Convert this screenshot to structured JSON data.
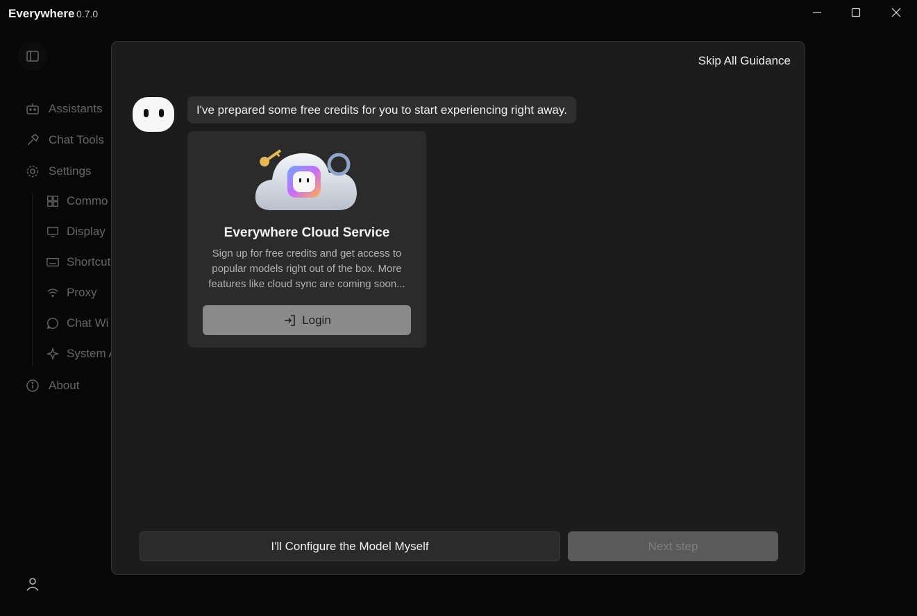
{
  "app": {
    "title": "Everywhere",
    "version": "0.7.0"
  },
  "window_controls": {
    "minimize": "minimize-icon",
    "maximize": "maximize-icon",
    "close": "close-icon"
  },
  "sidebar": {
    "items": [
      {
        "label": "Assistants",
        "icon": "robot-icon"
      },
      {
        "label": "Chat Tools",
        "icon": "hammer-icon"
      },
      {
        "label": "Settings",
        "icon": "gear-icon"
      }
    ],
    "sub_items": [
      {
        "label": "Commo",
        "icon": "grid-icon"
      },
      {
        "label": "Display",
        "icon": "monitor-icon"
      },
      {
        "label": "Shortcut",
        "icon": "keyboard-icon"
      },
      {
        "label": "Proxy",
        "icon": "wifi-icon"
      },
      {
        "label": "Chat Wi",
        "icon": "chat-icon"
      },
      {
        "label": "System A",
        "icon": "sparkle-icon"
      }
    ],
    "about": {
      "label": "About",
      "icon": "info-icon"
    }
  },
  "dialog": {
    "skip_label": "Skip All Guidance",
    "message": "I've prepared some free credits for you to start experiencing right away.",
    "card": {
      "title": "Everywhere Cloud Service",
      "description": "Sign up for free credits and get access to popular models right out of the box. More features like cloud sync are coming soon...",
      "login_label": "Login"
    },
    "configure_label": "I'll Configure the Model Myself",
    "next_label": "Next step"
  },
  "colors": {
    "dialog_bg": "#1c1c1c",
    "card_bg": "#2b2b2b",
    "login_button": "#8a8a8a",
    "next_button_disabled": "#5a5a5a"
  }
}
